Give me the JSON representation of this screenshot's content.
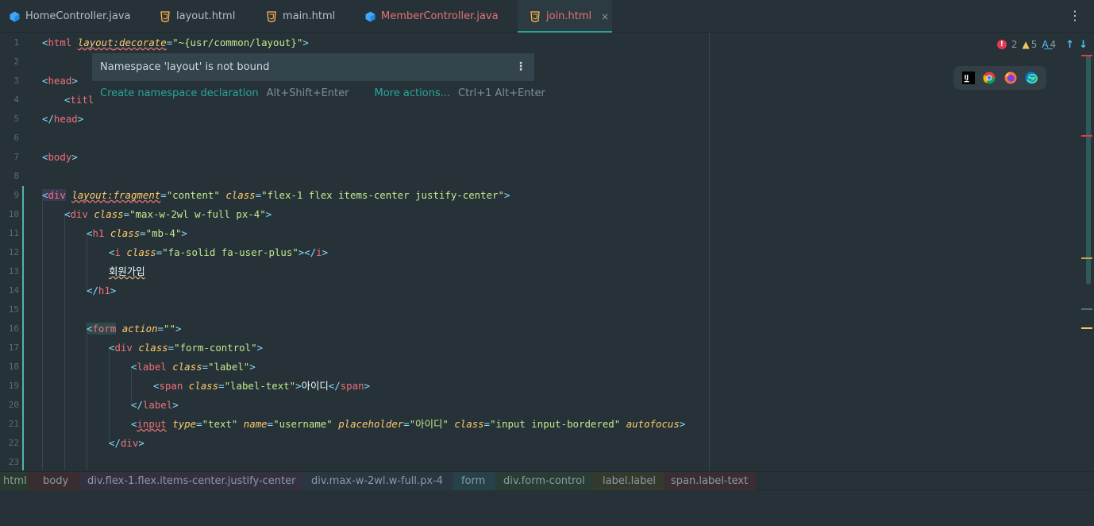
{
  "tabs": [
    {
      "label": "HomeController.java",
      "icon": "java-class-icon",
      "color": "#b0bec5"
    },
    {
      "label": "layout.html",
      "icon": "html-file-icon",
      "color": "#b0bec5"
    },
    {
      "label": "main.html",
      "icon": "html-file-icon",
      "color": "#b0bec5"
    },
    {
      "label": "MemberController.java",
      "icon": "java-class-icon",
      "color": "#e57373"
    },
    {
      "label": "join.html",
      "icon": "html-file-icon",
      "color": "#e57373",
      "active": true
    }
  ],
  "close_glyph": "×",
  "menu_glyph": "⋮",
  "line_numbers": [
    "1",
    "2",
    "3",
    "4",
    "5",
    "6",
    "7",
    "8",
    "9",
    "10",
    "11",
    "12",
    "13",
    "14",
    "15",
    "16",
    "17",
    "18",
    "19",
    "20",
    "21",
    "22",
    "23"
  ],
  "code": {
    "l1": {
      "lt": "<",
      "tag": "html",
      "attr_ns": "layout",
      "colon": ":",
      "attr": "decorate",
      "eq": "=",
      "val": "\"~{usr/common/layout}\"",
      "gt": ">"
    },
    "l3": {
      "lt": "<",
      "tag": "head",
      "gt": ">"
    },
    "l4": {
      "lt": "<",
      "tag": "titl"
    },
    "l5": {
      "lt": "</",
      "tag": "head",
      "gt": ">"
    },
    "l7": {
      "lt": "<",
      "tag": "body",
      "gt": ">"
    },
    "l9": {
      "lt": "<",
      "tag": "div",
      "attr_ns": "layout",
      "colon": ":",
      "attr": "fragment",
      "eq": "=",
      "val": "\"content\"",
      "attr2": "class",
      "val2": "\"flex-1 flex items-center justify-center\"",
      "gt": ">"
    },
    "l10": {
      "lt": "<",
      "tag": "div",
      "attr": "class",
      "eq": "=",
      "val": "\"max-w-2wl w-full px-4\"",
      "gt": ">"
    },
    "l11": {
      "lt": "<",
      "tag": "h1",
      "attr": "class",
      "eq": "=",
      "val": "\"mb-4\"",
      "gt": ">"
    },
    "l12": {
      "lt": "<",
      "tag": "i",
      "attr": "class",
      "eq": "=",
      "val": "\"fa-solid fa-user-plus\"",
      "gt": ">",
      "close_lt": "</",
      "close_tag": "i",
      "close_gt": ">"
    },
    "l13": {
      "text": "회원가입"
    },
    "l14": {
      "lt": "</",
      "tag": "h1",
      "gt": ">"
    },
    "l16": {
      "lt": "<",
      "tag": "form",
      "attr": "action",
      "eq": "=",
      "val": "\"\"",
      "gt": ">"
    },
    "l17": {
      "lt": "<",
      "tag": "div",
      "attr": "class",
      "eq": "=",
      "val": "\"form-control\"",
      "gt": ">"
    },
    "l18": {
      "lt": "<",
      "tag": "label",
      "attr": "class",
      "eq": "=",
      "val": "\"label\"",
      "gt": ">"
    },
    "l19": {
      "lt": "<",
      "tag": "span",
      "attr": "class",
      "eq": "=",
      "val": "\"label-text\"",
      "gt": ">",
      "text": "아이디",
      "close_lt": "</",
      "close_tag": "span",
      "close_gt": ">"
    },
    "l20": {
      "lt": "</",
      "tag": "label",
      "gt": ">"
    },
    "l21": {
      "lt": "<",
      "tag": "input",
      "attr": "type",
      "eq": "=",
      "val": "\"text\"",
      "attr2": "name",
      "val2": "\"username\"",
      "attr3": "placeholder",
      "val3": "\"아이디\"",
      "attr4": "class",
      "val4": "\"input input-bordered\"",
      "attr5": "autofocus",
      "gt": ">"
    },
    "l22": {
      "lt": "</",
      "tag": "div",
      "gt": ">"
    }
  },
  "inspections": {
    "errors": "2",
    "warnings": "5",
    "typos": "4",
    "error_glyph": "!",
    "warn_glyph": "▲",
    "typo_glyph": "A͟",
    "up": "↑",
    "down": "↓"
  },
  "browsers": [
    "intellij-icon",
    "chrome-icon",
    "firefox-icon",
    "edge-icon"
  ],
  "browser_ij_label": "IJ",
  "popup": {
    "message": "Namespace 'layout' is not bound",
    "dots": "⋮",
    "action1": "Create namespace declaration",
    "key1": "Alt+Shift+Enter",
    "action2": "More actions...",
    "key2": "Ctrl+1 Alt+Enter"
  },
  "breadcrumbs": [
    {
      "label": "html",
      "bg": "#2b3a2f"
    },
    {
      "label": "body",
      "bg": "#3a2d2f"
    },
    {
      "label": "div.flex-1.flex.items-center.justify-center",
      "bg": "#34303f"
    },
    {
      "label": "div.max-w-2wl.w-full.px-4",
      "bg": "#2a3640"
    },
    {
      "label": "form",
      "bg": "#26414a"
    },
    {
      "label": "div.form-control",
      "bg": "#2a3d34"
    },
    {
      "label": "label.label",
      "bg": "#343a2e"
    },
    {
      "label": "span.label-text",
      "bg": "#3b2e32"
    }
  ]
}
